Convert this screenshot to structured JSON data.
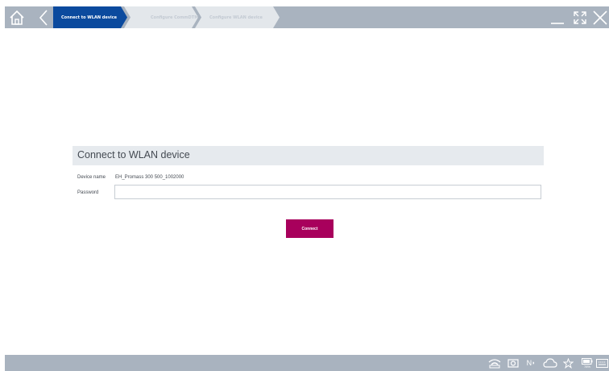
{
  "wizard": {
    "steps": [
      {
        "label": "Connect to WLAN device",
        "state": "active"
      },
      {
        "label": "Configure CommDTM",
        "state": "inactive"
      },
      {
        "label": "Configure WLAN device",
        "state": "inactive"
      }
    ]
  },
  "form": {
    "title": "Connect to WLAN device",
    "device_name_label": "Device name",
    "device_name_value": "EH_Promass 300 500_1002000",
    "password_label": "Password",
    "password_value": "",
    "connect_label": "Connect"
  },
  "colors": {
    "bar": "#a9b3bf",
    "active_step": "#0b4a9e",
    "inactive_step": "#e3e7eb",
    "connect_button": "#a8005c",
    "form_header": "#e6eaee"
  },
  "icons": {
    "home": "home-icon",
    "back": "back-arrow-icon",
    "minimize": "minimize-icon",
    "maximize": "maximize-icon",
    "close": "close-icon",
    "tray": [
      "wlan-icon",
      "camera-icon",
      "nfc-icon",
      "cloud-icon",
      "star-icon",
      "battery-icon",
      "keyboard-icon"
    ]
  },
  "status": {
    "nfc_text": "N",
    "battery_percent": "78%"
  }
}
